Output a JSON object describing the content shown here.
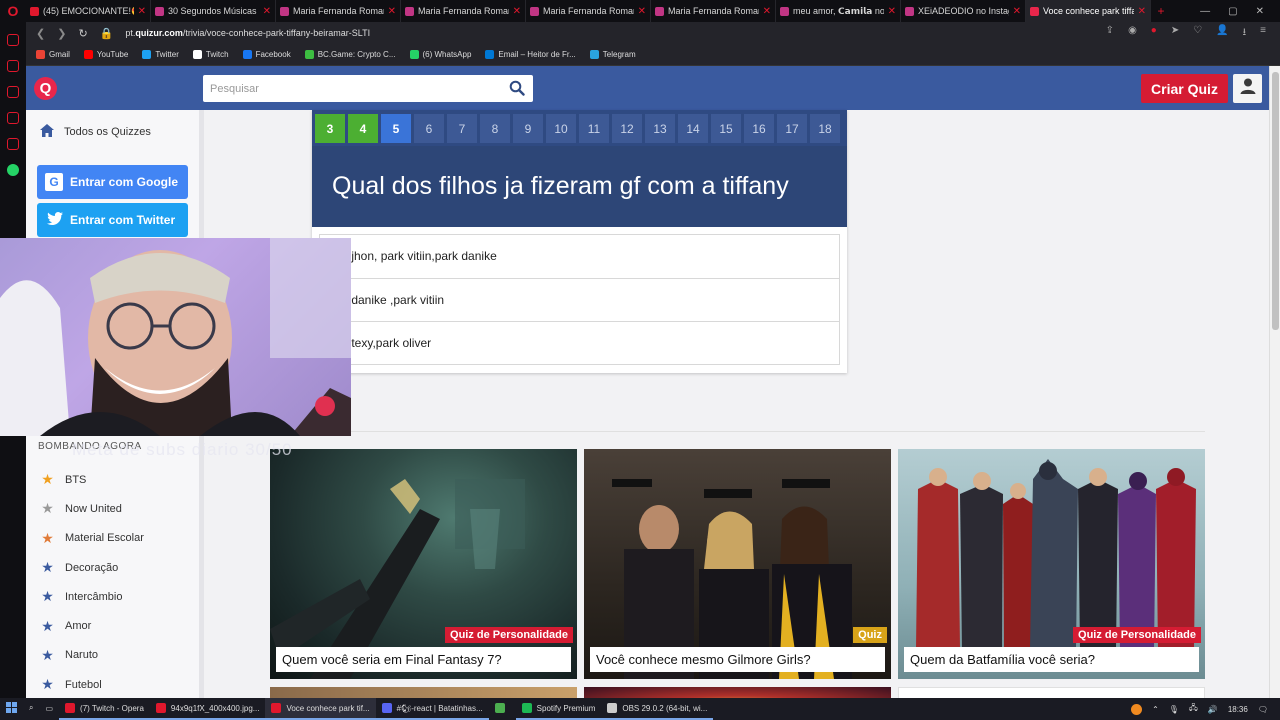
{
  "browser": {
    "tabs": [
      {
        "title": "(45) EMOCIONANTE!😍 C",
        "color": "#e0182d",
        "active": false
      },
      {
        "title": "30 Segundos Músicas no",
        "color": "#c13584",
        "active": false
      },
      {
        "title": "Maria Fernanda Romanel",
        "color": "#c13584",
        "active": false
      },
      {
        "title": "Maria Fernanda Romanel",
        "color": "#c13584",
        "active": false
      },
      {
        "title": "Maria Fernanda Romanel",
        "color": "#c13584",
        "active": false
      },
      {
        "title": "Maria Fernanda Romanel",
        "color": "#c13584",
        "active": false
      },
      {
        "title": "meu amor, 𝗖𝗮𝗺𝗶𝗹𝗮 no Ins",
        "color": "#c13584",
        "active": false
      },
      {
        "title": "XEiADEODIO no Instagra",
        "color": "#c13584",
        "active": false
      },
      {
        "title": "Voce conhece park tiffany",
        "color": "#e8264b",
        "active": true
      }
    ],
    "url_prefix": "pt.",
    "url_domain": "quizur.com",
    "url_path": "/trivia/voce-conhece-park-tiffany-beiramar-SLTI",
    "bookmarks": [
      {
        "label": "Gmail",
        "color": "#ea4335"
      },
      {
        "label": "YouTube",
        "color": "#ff0000"
      },
      {
        "label": "Twitter",
        "color": "#1da1f2"
      },
      {
        "label": "Twitch",
        "color": "#ffffff"
      },
      {
        "label": "Facebook",
        "color": "#1877f2"
      },
      {
        "label": "BC.Game: Crypto C...",
        "color": "#3dbd41"
      },
      {
        "label": "(6) WhatsApp",
        "color": "#25d366"
      },
      {
        "label": "Email – Heitor de Fr...",
        "color": "#0078d4"
      },
      {
        "label": "Telegram",
        "color": "#2aa3de"
      }
    ]
  },
  "header": {
    "logo_letter": "Q",
    "search_placeholder": "Pesquisar",
    "create_quiz": "Criar Quiz"
  },
  "sidebar": {
    "all_quizzes": "Todos os Quizzes",
    "google_login": "Entrar com Google",
    "google_letter": "G",
    "twitter_login": "Entrar com Twitter",
    "section_title": "BOMBANDO AGORA",
    "categories": [
      {
        "label": "BTS",
        "color": "#f0a020"
      },
      {
        "label": "Now United",
        "color": "#999999"
      },
      {
        "label": "Material Escolar",
        "color": "#e07b39"
      },
      {
        "label": "Decoração",
        "color": "#3a5a9f"
      },
      {
        "label": "Intercâmbio",
        "color": "#3a5a9f"
      },
      {
        "label": "Amor",
        "color": "#3a5a9f"
      },
      {
        "label": "Naruto",
        "color": "#3a5a9f"
      },
      {
        "label": "Futebol",
        "color": "#3a5a9f"
      }
    ]
  },
  "quiz": {
    "questions": [
      {
        "n": "3",
        "state": "done"
      },
      {
        "n": "4",
        "state": "done"
      },
      {
        "n": "5",
        "state": "current"
      },
      {
        "n": "6",
        "state": ""
      },
      {
        "n": "7",
        "state": ""
      },
      {
        "n": "8",
        "state": ""
      },
      {
        "n": "9",
        "state": ""
      },
      {
        "n": "10",
        "state": ""
      },
      {
        "n": "11",
        "state": ""
      },
      {
        "n": "12",
        "state": ""
      },
      {
        "n": "13",
        "state": ""
      },
      {
        "n": "14",
        "state": ""
      },
      {
        "n": "15",
        "state": ""
      },
      {
        "n": "16",
        "state": ""
      },
      {
        "n": "17",
        "state": ""
      },
      {
        "n": "18",
        "state": ""
      }
    ],
    "question": "Qual dos filhos ja fizeram gf com a tiffany",
    "answers": [
      "k jhon, park vitiin,park danike",
      "k danike ,park vitiin",
      "k texy,park oliver"
    ]
  },
  "overlay": {
    "subs_text": "Meta de subs diario 30/50"
  },
  "cards": [
    {
      "badge": "Quiz de Personalidade",
      "badge_color": "red",
      "title": "Quem você seria em Final Fantasy 7?"
    },
    {
      "badge": "Quiz",
      "badge_color": "yellow",
      "title": "Você conhece mesmo Gilmore Girls?"
    },
    {
      "badge": "Quiz de Personalidade",
      "badge_color": "red",
      "title": "Quem da Batfamília você seria?"
    }
  ],
  "taskbar": {
    "items": [
      {
        "label": "(7) Twitch - Opera",
        "color": "#e0182d",
        "state": "open"
      },
      {
        "label": "94x9q1fX_400x400.jpg...",
        "color": "#e0182d",
        "state": "open"
      },
      {
        "label": "Voce conhece park tif...",
        "color": "#e0182d",
        "state": "active"
      },
      {
        "label": "#🐿-react | Batatinhas...",
        "color": "#5865f2",
        "state": "open"
      },
      {
        "label": "",
        "color": "#4caf50",
        "state": ""
      },
      {
        "label": "Spotify Premium",
        "color": "#1db954",
        "state": "open"
      },
      {
        "label": "OBS 29.0.2 (64-bit, wi...",
        "color": "#cccccc",
        "state": "open"
      }
    ],
    "clock": "18:36"
  }
}
